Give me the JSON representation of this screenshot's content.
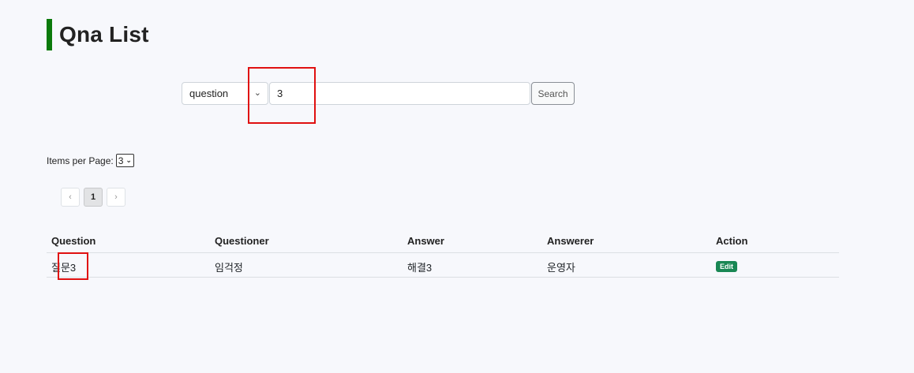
{
  "header": {
    "title": "Qna List"
  },
  "search": {
    "field_selected": "question",
    "query_value": "3",
    "button_label": "Search"
  },
  "pagination": {
    "items_per_page_label": "Items per Page:",
    "items_per_page_value": "3",
    "prev": "‹",
    "current_page": "1",
    "next": "›"
  },
  "table": {
    "columns": [
      "Question",
      "Questioner",
      "Answer",
      "Answerer",
      "Action"
    ],
    "rows": [
      {
        "question": "질문3",
        "questioner": "임걱정",
        "answer": "해결3",
        "answerer": "운영자",
        "action": "Edit"
      }
    ]
  },
  "colors": {
    "accent_bar": "#0b7a0b",
    "edit_badge": "#198754",
    "highlight": "#e01010"
  }
}
